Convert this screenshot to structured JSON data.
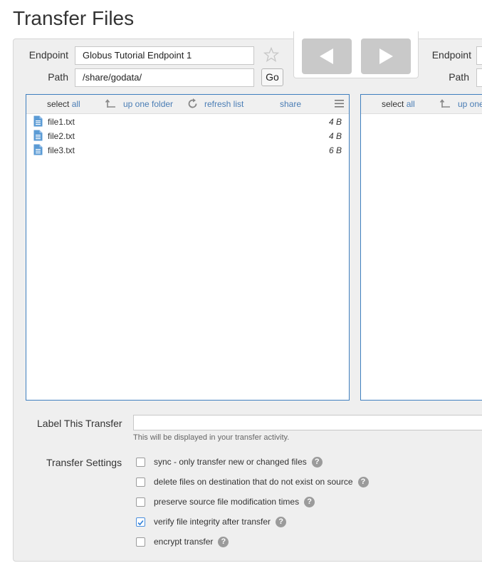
{
  "page": {
    "title": "Transfer Files"
  },
  "left": {
    "endpoint_label": "Endpoint",
    "endpoint_value": "Globus Tutorial Endpoint 1",
    "path_label": "Path",
    "path_value": "/share/godata/",
    "go_label": "Go",
    "toolbar": {
      "select_prefix": "select",
      "select_all": "all",
      "up_folder": "up one folder",
      "refresh": "refresh list",
      "share": "share"
    },
    "files": [
      {
        "name": "file1.txt",
        "size": "4 B"
      },
      {
        "name": "file2.txt",
        "size": "4 B"
      },
      {
        "name": "file3.txt",
        "size": "6 B"
      }
    ]
  },
  "right": {
    "endpoint_label": "Endpoint",
    "path_label": "Path",
    "toolbar": {
      "select_prefix": "select",
      "select_all": "all",
      "up_folder_partial": "up one"
    }
  },
  "transfer": {
    "label_title": "Label This Transfer",
    "label_value": "",
    "label_hint": "This will be displayed in your transfer activity.",
    "settings_title": "Transfer Settings",
    "options": [
      {
        "label": "sync - only transfer new or changed files",
        "checked": false
      },
      {
        "label": "delete files on destination that do not exist on source",
        "checked": false
      },
      {
        "label": "preserve source file modification times",
        "checked": false
      },
      {
        "label": "verify file integrity after transfer",
        "checked": true
      },
      {
        "label": "encrypt transfer",
        "checked": false
      }
    ]
  },
  "icons": {
    "star": "star-icon",
    "arrow_left": "arrow-left-icon",
    "arrow_right": "arrow-right-icon",
    "up_folder": "up-folder-icon",
    "refresh": "refresh-icon",
    "menu": "menu-icon",
    "file": "file-icon",
    "help": "help-icon",
    "check": "checkmark-icon"
  },
  "colors": {
    "accent": "#3f7fbf",
    "link": "#4a7db5",
    "arrow_button": "#c9c9c9"
  }
}
